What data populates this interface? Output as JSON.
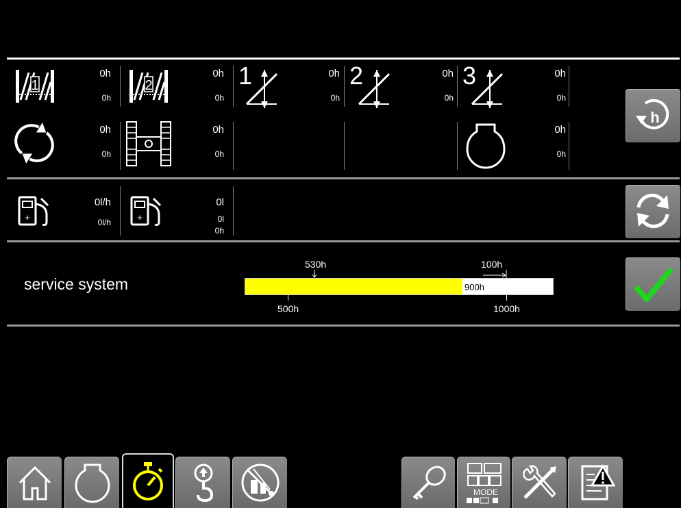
{
  "rows_top": {
    "winch1": {
      "total": "0h",
      "sub": "0h"
    },
    "winch2": {
      "total": "0h",
      "sub": "0h"
    },
    "luffing1": {
      "number": "1",
      "total": "0h",
      "sub": "0h"
    },
    "luffing2": {
      "number": "2",
      "total": "0h",
      "sub": "0h"
    },
    "luffing3": {
      "number": "3",
      "total": "0h",
      "sub": "0h"
    },
    "slewing": {
      "total": "0h",
      "sub": "0h"
    },
    "crawler": {
      "total": "0h",
      "sub": "0h"
    },
    "engine": {
      "total": "0h",
      "sub": "0h"
    }
  },
  "fuel": {
    "rate": {
      "value": "0l/h",
      "sub": "0l/h"
    },
    "consumption": {
      "value": "0l",
      "sub1": "0l",
      "sub2": "0h"
    }
  },
  "service": {
    "title": "service system",
    "marker_top_left": "530h",
    "marker_top_right": "100h",
    "bar_value_label": "900h",
    "tick_left": "500h",
    "tick_right": "1000h",
    "progress_fraction": 0.705,
    "fill_color": "#ffff00"
  },
  "side_buttons": [
    "reset-hours-icon",
    "refresh-icon",
    "confirm-checkmark-icon"
  ],
  "tabs": [
    "home-icon",
    "engine-icon",
    "stopwatch-icon",
    "crane-hook-icon",
    "crane-no-load-icon",
    "key-icon",
    "mode-icon",
    "tools-icon",
    "warning-log-icon"
  ],
  "tabs_mode_label": "MODE"
}
